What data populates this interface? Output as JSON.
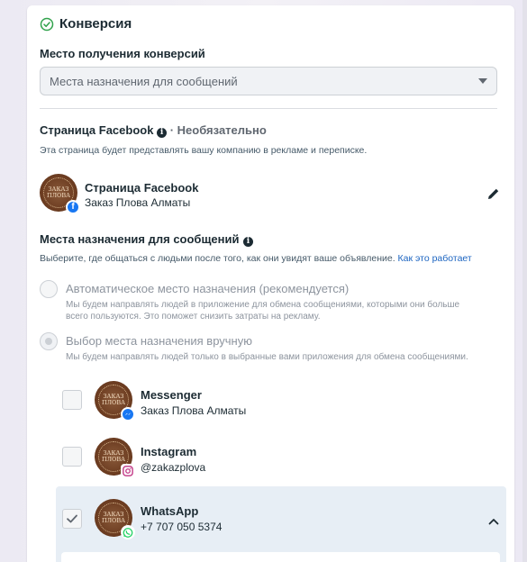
{
  "section": {
    "title": "Конверсия",
    "conversion_location_label": "Место получения конверсий",
    "conversion_location_value": "Места назначения для сообщений"
  },
  "facebook_page": {
    "heading": "Страница Facebook",
    "optional_label": "· Необязательно",
    "description": "Эта страница будет представлять вашу компанию в рекламе и переписке.",
    "name": "Страница Facebook",
    "account": "Заказ Плова Алматы"
  },
  "destinations": {
    "heading": "Места назначения для сообщений",
    "description": "Выберите, где общаться с людьми после того, как они увидят ваше объявление.",
    "link": "Как это работает",
    "options": [
      {
        "title": "Автоматическое место назначения (рекомендуется)",
        "desc_line1": "Мы будем направлять людей в приложение для обмена сообщениями, которыми они больше",
        "desc_line2": "всего пользуются. Это поможет снизить затраты на рекламу."
      },
      {
        "title": "Выбор места назначения вручную",
        "desc_line1": "Мы будем направлять людей только в выбранные вами приложения для обмена сообщениями."
      }
    ],
    "apps": [
      {
        "name": "Messenger",
        "account": "Заказ Плова Алматы",
        "checked": false,
        "icon": "messenger-icon"
      },
      {
        "name": "Instagram",
        "account": "@zakazplova",
        "checked": false,
        "icon": "instagram-icon"
      },
      {
        "name": "WhatsApp",
        "account": "+7 707 050 5374",
        "checked": true,
        "icon": "whatsapp-icon"
      }
    ]
  },
  "avatar_text": "ЗАКАЗ ПЛОВА",
  "colors": {
    "accent": "#1877f2",
    "success": "#31a24c",
    "whatsapp": "#25d366",
    "panel": "#e7eef5"
  }
}
